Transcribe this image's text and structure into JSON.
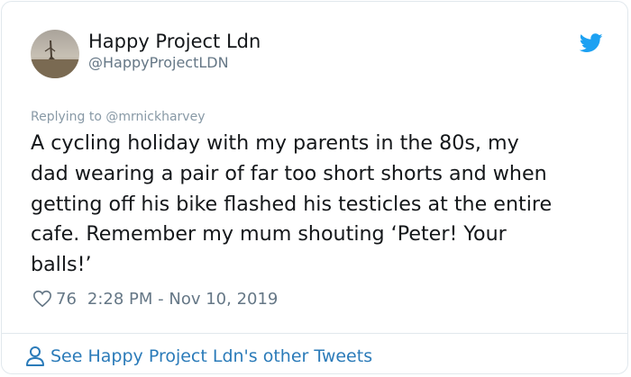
{
  "tweet": {
    "author_name": "Happy Project Ldn",
    "author_handle": "@HappyProjectLDN",
    "reply_to": "Replying to @mrnickharvey",
    "text": "A cycling holiday with my parents in the 80s, my\ndad wearing a pair of far too short shorts and when\ngetting off his bike flashed his testicles at the entire\ncafe. Remember my mum shouting ‘Peter! Your\nballs!’",
    "likes": "76",
    "timestamp": "2:28 PM - Nov 10, 2019",
    "more_link": "See Happy Project Ldn's other Tweets"
  },
  "icons": {
    "brand": "twitter-bird-icon",
    "like": "heart-icon",
    "profile": "person-icon"
  },
  "colors": {
    "brand_blue": "#1da1f2",
    "link_blue": "#2b7bb9",
    "text_primary": "#14171a",
    "text_secondary": "#657786",
    "border": "#e1e8ed"
  }
}
